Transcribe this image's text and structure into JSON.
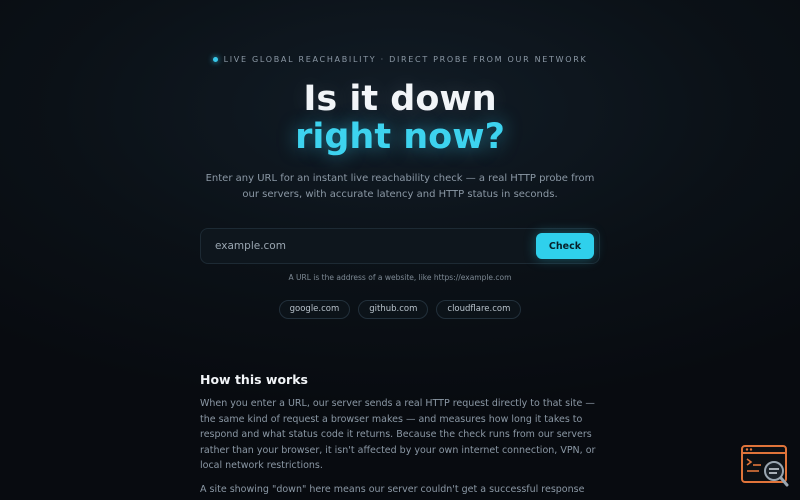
{
  "hero": {
    "eyebrow": "LIVE GLOBAL REACHABILITY · DIRECT PROBE FROM OUR NETWORK",
    "title_line1": "Is it down",
    "title_line2": "right now?",
    "subtitle": "Enter any URL for an instant live reachability check — a real HTTP probe from our servers, with accurate latency and HTTP status in seconds."
  },
  "search": {
    "placeholder": "example.com",
    "button_label": "Check",
    "hint": "A URL is the address of a website, like https://example.com"
  },
  "quick_links": [
    "google.com",
    "github.com",
    "cloudflare.com"
  ],
  "how_it_works": {
    "title": "How this works",
    "paragraph1": "When you enter a URL, our server sends a real HTTP request directly to that site — the same kind of request a browser makes — and measures how long it takes to respond and what status code it returns. Because the check runs from our servers rather than your browser, it isn't affected by your own internet connection, VPN, or local network restrictions.",
    "paragraph2": "A site showing \"down\" here means our server couldn't get a successful response within"
  },
  "colors": {
    "accent": "#2fd0ec",
    "background": "#080b10",
    "widget": "#e0743a"
  },
  "icons": {
    "status_dot": "live-dot-icon",
    "widget": "terminal-search-icon"
  }
}
